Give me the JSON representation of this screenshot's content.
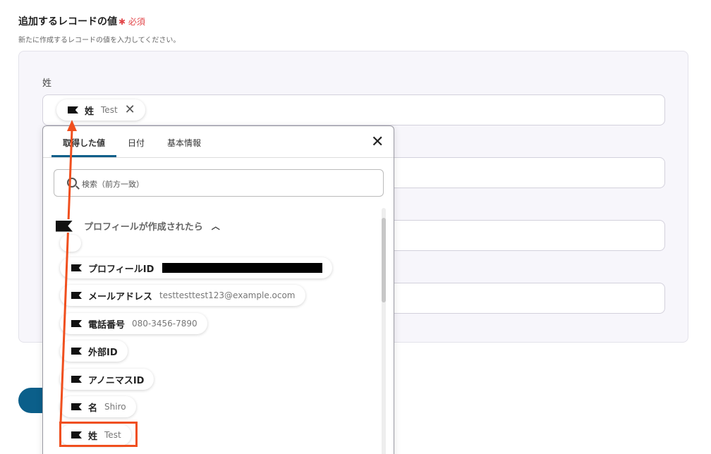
{
  "section": {
    "title": "追加するレコードの値",
    "required": "✱ 必須",
    "description": "新たに作成するレコードの値を入力してください。"
  },
  "field": {
    "label": "姓",
    "chip_name": "姓",
    "chip_value": "Test"
  },
  "popup": {
    "tabs": [
      "取得した値",
      "日付",
      "基本情報"
    ],
    "search_placeholder": "検索（前方一致）",
    "group_title": "プロフィールが作成されたら",
    "items": [
      {
        "name": "プロフィールID",
        "value": ""
      },
      {
        "name": "メールアドレス",
        "value": "testtesttest123@example.ocom"
      },
      {
        "name": "電話番号",
        "value": "080-3456-7890"
      },
      {
        "name": "外部ID",
        "value": ""
      },
      {
        "name": "アノニマスID",
        "value": ""
      },
      {
        "name": "名",
        "value": "Shiro"
      },
      {
        "name": "姓",
        "value": "Test"
      }
    ]
  },
  "colors": {
    "accent": "#0b5f8a",
    "required": "#e2474a",
    "annotation": "#f04f1e"
  }
}
